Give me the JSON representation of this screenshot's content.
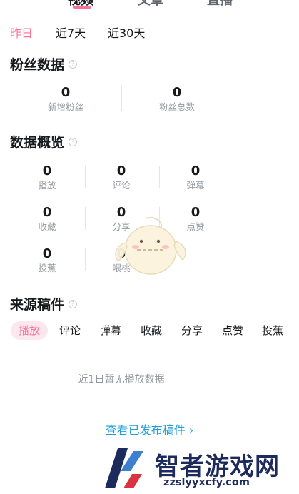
{
  "top_tabs": [
    {
      "label": "视频",
      "active": true
    },
    {
      "label": "文章",
      "active": false
    },
    {
      "label": "直播",
      "active": false
    }
  ],
  "date_filters": [
    {
      "label": "昨日",
      "active": true
    },
    {
      "label": "近7天",
      "active": false
    },
    {
      "label": "近30天",
      "active": false
    }
  ],
  "fans": {
    "title": "粉丝数据",
    "stats": [
      {
        "value": "0",
        "label": "新增粉丝"
      },
      {
        "value": "0",
        "label": "粉丝总数"
      }
    ]
  },
  "overview": {
    "title": "数据概览",
    "stats": [
      {
        "value": "0",
        "label": "播放"
      },
      {
        "value": "0",
        "label": "评论"
      },
      {
        "value": "0",
        "label": "弹幕"
      },
      {
        "value": "0",
        "label": "收藏"
      },
      {
        "value": "0",
        "label": "分享"
      },
      {
        "value": "0",
        "label": "点赞"
      },
      {
        "value": "0",
        "label": "投蕉"
      },
      {
        "value": "0",
        "label": "喂桃"
      }
    ]
  },
  "sources": {
    "title": "来源稿件",
    "tabs": [
      {
        "label": "播放",
        "active": true
      },
      {
        "label": "评论",
        "active": false
      },
      {
        "label": "弹幕",
        "active": false
      },
      {
        "label": "收藏",
        "active": false
      },
      {
        "label": "分享",
        "active": false
      },
      {
        "label": "点赞",
        "active": false
      },
      {
        "label": "投蕉",
        "active": false
      }
    ],
    "empty_message": "近1日暂无播放数据"
  },
  "view_published_link": "查看已发布稿件 ›",
  "watermark": {
    "text": "智者游戏网",
    "url": "zzslyyxcfy.com"
  },
  "colors": {
    "accent": "#fb7299",
    "link": "#1e9fd9",
    "muted": "#9499a0"
  }
}
